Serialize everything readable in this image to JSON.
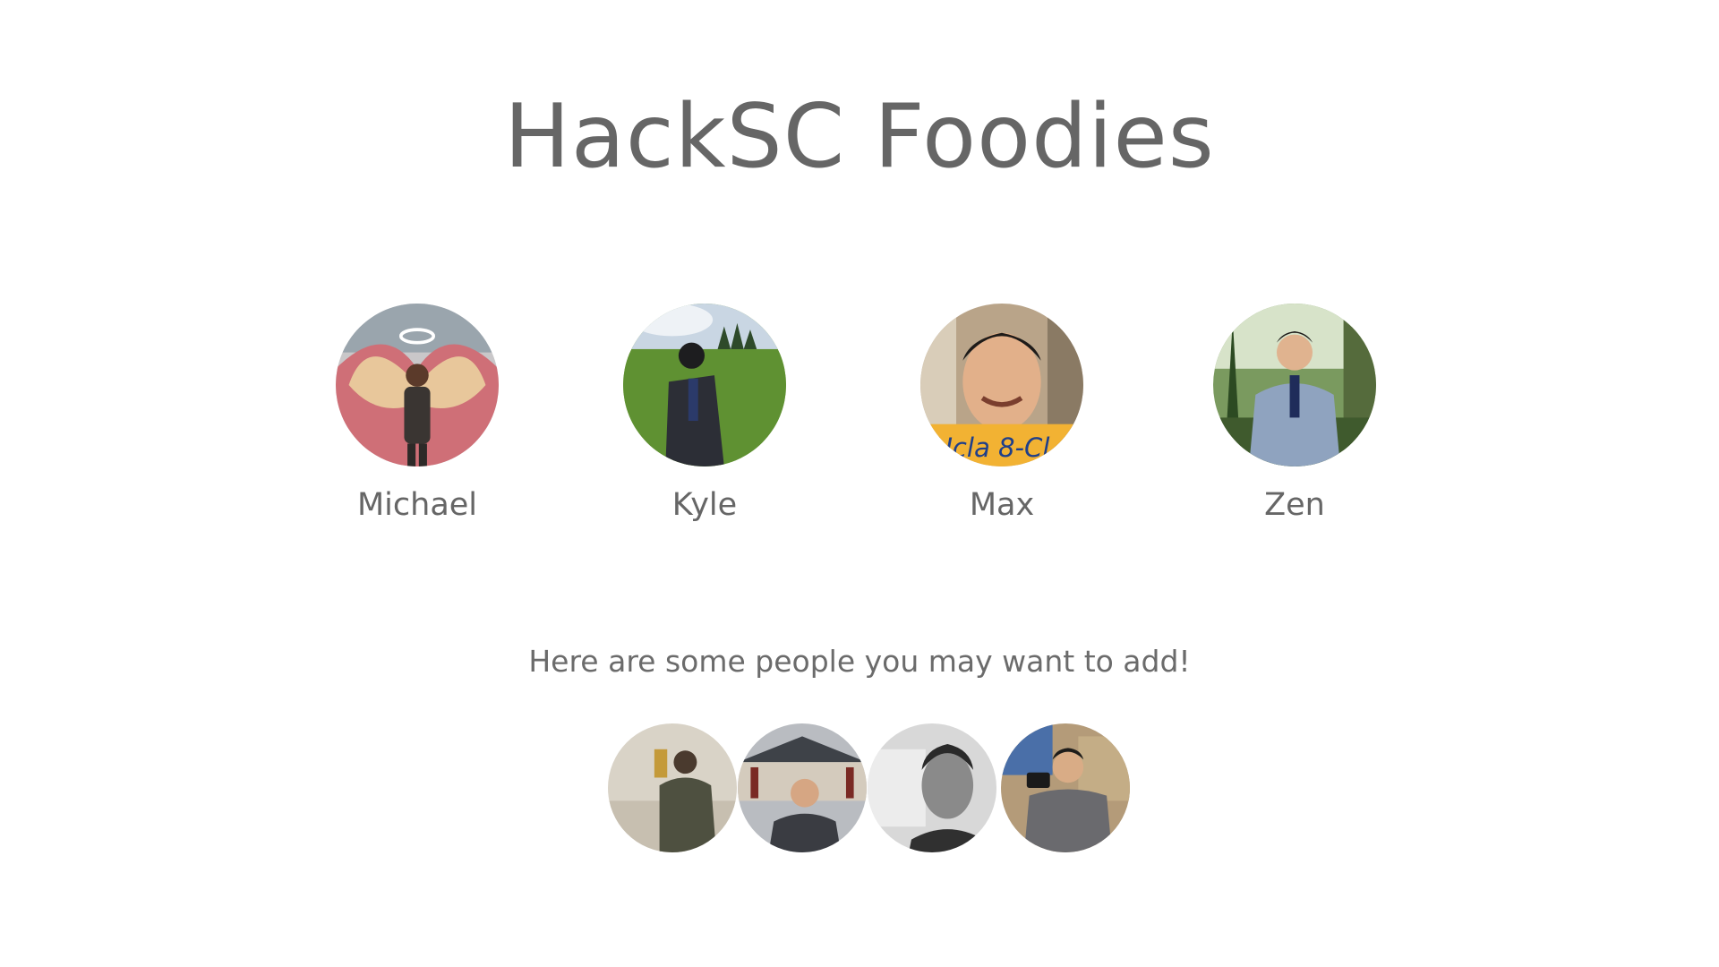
{
  "title": "HackSC Foodies",
  "members": [
    {
      "name": "Michael",
      "icon": "person-with-wings-photo"
    },
    {
      "name": "Kyle",
      "icon": "person-in-suit-grass-photo"
    },
    {
      "name": "Max",
      "icon": "smiling-person-portrait-photo"
    },
    {
      "name": "Zen",
      "icon": "person-in-gray-suit-photo"
    }
  ],
  "suggestions": {
    "heading": "Here are some people you may want to add!",
    "people": [
      {
        "icon": "person-in-museum-photo"
      },
      {
        "icon": "person-in-front-of-building-photo"
      },
      {
        "icon": "black-and-white-selfie-photo"
      },
      {
        "icon": "person-with-camera-photo"
      }
    ]
  },
  "colors": {
    "text": "#666666",
    "background": "#ffffff"
  }
}
